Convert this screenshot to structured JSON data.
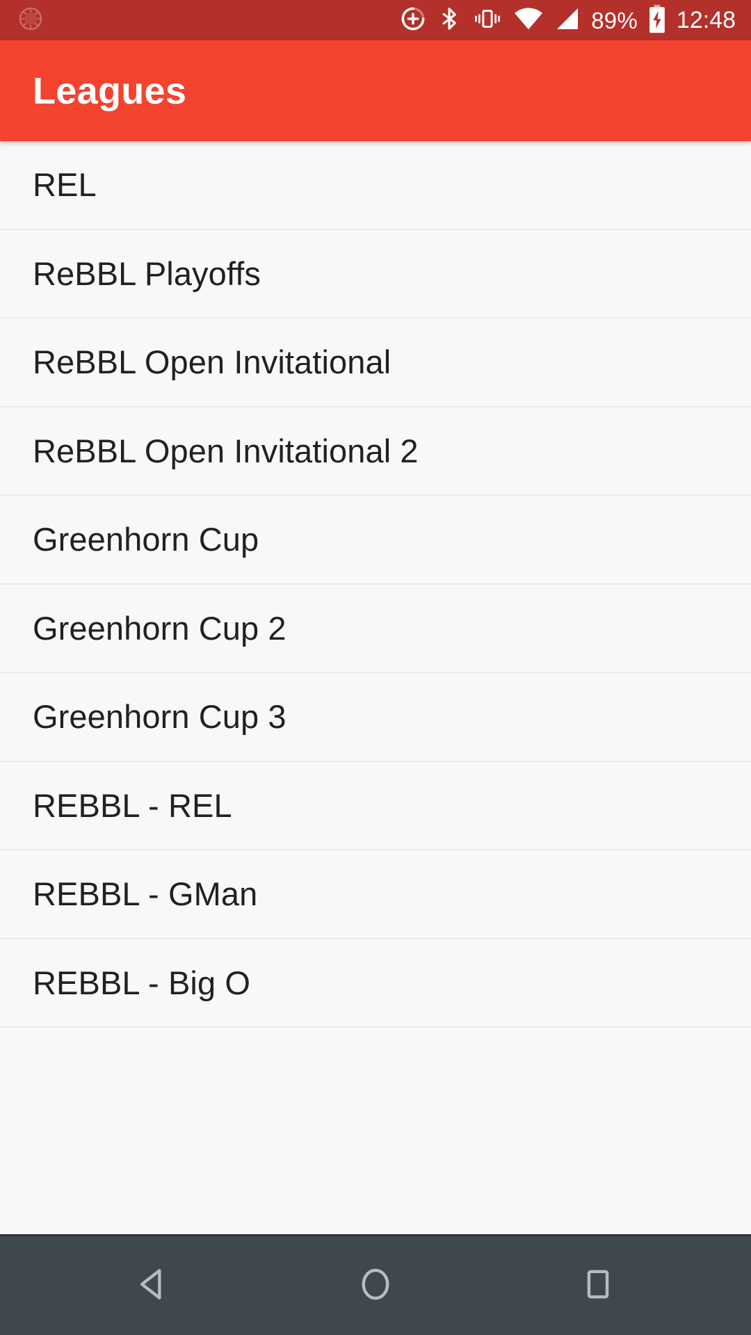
{
  "status_bar": {
    "background_color": "#b4302a",
    "notification_icon": "sun-burst-notification-icon",
    "icons": [
      "alarm-add-icon",
      "bluetooth-icon",
      "vibrate-icon",
      "wifi-icon",
      "cellular-signal-icon"
    ],
    "battery_percent": "89%",
    "battery_icon": "battery-charging-icon",
    "time": "12:48"
  },
  "app_bar": {
    "title": "Leagues",
    "background_color": "#f4432f",
    "text_color": "#ffffff"
  },
  "list": {
    "background_color": "#f8f8f8",
    "divider_color": "#ebebeb",
    "text_color": "#212121",
    "items": [
      {
        "label": "REL"
      },
      {
        "label": "ReBBL Playoffs"
      },
      {
        "label": "ReBBL Open Invitational"
      },
      {
        "label": "ReBBL Open Invitational 2"
      },
      {
        "label": "Greenhorn Cup"
      },
      {
        "label": "Greenhorn Cup 2"
      },
      {
        "label": "Greenhorn Cup 3"
      },
      {
        "label": "REBBL - REL"
      },
      {
        "label": "REBBL - GMan"
      },
      {
        "label": "REBBL - Big O"
      }
    ]
  },
  "nav_bar": {
    "background_color": "#3f484c",
    "icon_color": "#b6bcbf",
    "buttons": [
      {
        "name": "back-button",
        "icon": "back-triangle-icon"
      },
      {
        "name": "home-button",
        "icon": "home-circle-icon"
      },
      {
        "name": "recents-button",
        "icon": "recents-square-icon"
      }
    ]
  }
}
